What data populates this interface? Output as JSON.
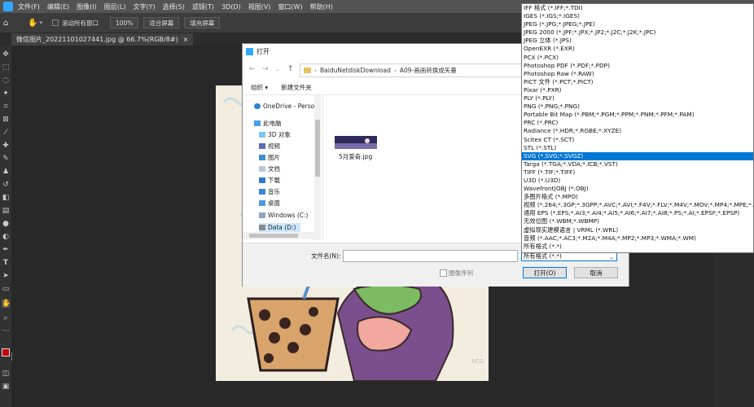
{
  "menubar": {
    "items": [
      "文件(F)",
      "编辑(E)",
      "图像(I)",
      "图层(L)",
      "文字(Y)",
      "选择(S)",
      "滤镜(T)",
      "3D(D)",
      "视图(V)",
      "窗口(W)",
      "帮助(H)"
    ]
  },
  "options_bar": {
    "checkbox_label": "滚动所有窗口",
    "zoom": "100%",
    "fit_screen": "适合屏幕",
    "fill_screen": "填充屏幕"
  },
  "document_tab": {
    "label": "微信图片_20221101027441.jpg @ 66.7%(RGB/8#)",
    "close": "×"
  },
  "dialog": {
    "title": "打开",
    "path": [
      "BaiduNetdiskDownload",
      "A09-画画转换成矢量"
    ],
    "organize": "组织 ▾",
    "new_folder": "新建文件夹",
    "nav_items": [
      "OneDrive - Perso",
      "此电脑",
      "3D 对象",
      "视频",
      "图片",
      "文档",
      "下载",
      "音乐",
      "桌面",
      "Windows (C:)",
      "Data (D:)"
    ],
    "file": {
      "name": "5月爱奇.jpg"
    },
    "filename_label": "文件名(N):",
    "filename_value": "",
    "sequence_label": "图像序列",
    "filetype_value": "所有格式 (*.*)",
    "open_button": "打开(O)",
    "cancel_button": "取消"
  },
  "format_list": {
    "items": [
      "IFF 格式 (*.IFF;*.TDI)",
      "IGES (*.IGS;*.IGES)",
      "JPEG (*.JPG;*.JPEG;*.JPE)",
      "JPEG 2000 (*.JPF;*.JPX;*.JP2;*.J2C;*.J2K;*.JPC)",
      "JPEG 立体 (*.JPS)",
      "OpenEXR (*.EXR)",
      "PCX (*.PCX)",
      "Photoshop PDF (*.PDF;*.PDP)",
      "Photoshop Raw (*.RAW)",
      "PICT 文件 (*.PCT;*.PICT)",
      "Pixar (*.PXR)",
      "PLY (*.PLY)",
      "PNG (*.PNG;*.PNG)",
      "Portable Bit Map (*.PBM;*.PGM;*.PPM;*.PNM;*.PFM;*.PAM)",
      "PRC (*.PRC)",
      "Radiance (*.HDR;*.RGBE;*.XYZE)",
      "Scitex CT (*.SCT)",
      "STL (*.STL)",
      "SVG (*.SVG;*.SVGZ)",
      "Targa (*.TGA;*.VDA;*.ICB;*.VST)",
      "TIFF (*.TIF;*.TIFF)",
      "U3D (*.U3D)",
      "Wavefront|OBJ (*.OBJ)",
      "多图片格式 (*.MPO)",
      "视频 (*.264;*.3GP;*.3GPP;*.AVC;*.AVI;*.F4V;*.FLV;*.M4V;*.MOV;*.MP4;*.MPE;*.MPEG)",
      "通用 EPS (*.EPS;*.AI3;*.AI4;*.AI5;*.AI6;*.AI7;*.AI8;*.PS;*.AI;*.EPSF;*.EPSP)",
      "无效位图 (*.WBM;*.WBMP)",
      "虚拟现实建模语言 | VRML (*.WRL)",
      "音频 (*.AAC;*.AC3;*.M2A;*.M4A;*.MP2;*.MP3;*.WMA;*.WM)",
      "所有格式 (*.*)"
    ],
    "selected_index": 18
  },
  "canvas": {
    "watermark": "ACG"
  },
  "colors": {
    "selected": "#0078d7",
    "foreground": "#c80000",
    "background": "#ffffff"
  }
}
